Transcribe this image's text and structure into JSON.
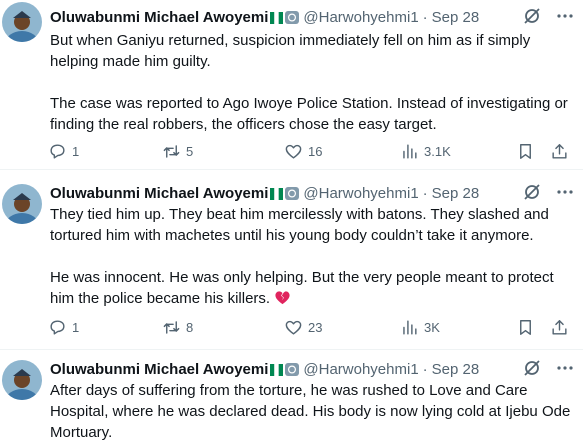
{
  "tweets": [
    {
      "author": "Oluwabunmi Michael Awoyemi",
      "handle": "@Harwohyehmi1",
      "dot": "·",
      "date": "Sep 28",
      "paragraphs": [
        "But when Ganiyu returned, suspicion immediately fell on him as if simply helping made him guilty.",
        "The case was reported to Ago Iwoye Police Station. Instead of investigating or finding the real robbers, the officers chose the easy target."
      ],
      "replies": "1",
      "reposts": "5",
      "likes": "16",
      "views": "3.1K"
    },
    {
      "author": "Oluwabunmi Michael Awoyemi",
      "handle": "@Harwohyehmi1",
      "dot": "·",
      "date": "Sep 28",
      "paragraphs": [
        "They tied him up. They beat him mercilessly with batons. They slashed and tortured him with machetes until his young body couldn’t take it anymore.",
        "He was innocent. He was only helping. But the very people meant to protect him the police became his killers."
      ],
      "replies": "1",
      "reposts": "8",
      "likes": "23",
      "views": "3K"
    },
    {
      "author": "Oluwabunmi Michael Awoyemi",
      "handle": "@Harwohyehmi1",
      "dot": "·",
      "date": "Sep 28",
      "paragraphs": [
        "After days of suffering from the torture, he was rushed to Love and Care Hospital, where he was declared dead. His body is now lying cold at Ijebu Ode Mortuary."
      ]
    }
  ],
  "icons": {
    "flag": "nigeria-flag-icon",
    "badge": "government-badge-icon",
    "grok": "grok-icon",
    "more": "more-icon",
    "reply": "reply-icon",
    "repost": "repost-icon",
    "like": "heart-icon",
    "views": "views-icon",
    "bookmark": "bookmark-icon",
    "share": "share-icon",
    "broken_heart": "broken-heart-emoji"
  },
  "colors": {
    "text": "#0f1419",
    "secondary": "#536471",
    "divider": "#eff3f4",
    "flag_green": "#008751",
    "broken_heart": "#e0245e"
  }
}
